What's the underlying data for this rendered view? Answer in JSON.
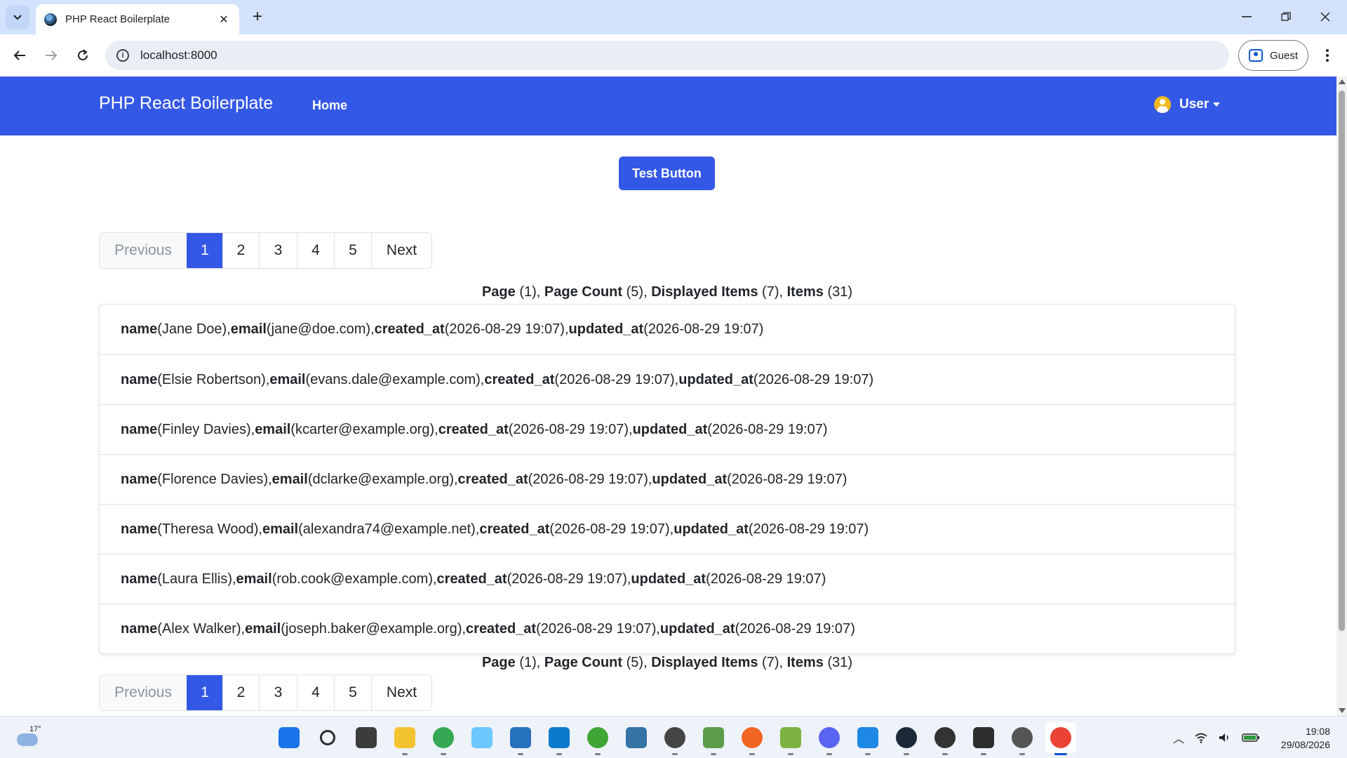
{
  "browser": {
    "tab_title": "PHP React Boilerplate",
    "url": "localhost:8000",
    "profile_label": "Guest"
  },
  "navbar": {
    "brand": "PHP React Boilerplate",
    "home_link": "Home",
    "user_label": "User"
  },
  "test_button": "Test Button",
  "pagination": {
    "previous": "Previous",
    "next": "Next",
    "pages": [
      "1",
      "2",
      "3",
      "4",
      "5"
    ],
    "active_page": "1"
  },
  "summary": {
    "page_label": "Page",
    "page_value": "(1)",
    "page_count_label": "Page Count",
    "page_count_value": "(5)",
    "displayed_label": "Displayed Items",
    "displayed_value": "(7)",
    "items_label": "Items",
    "items_value": "(31)"
  },
  "field_labels": {
    "name": "name",
    "email": "email",
    "created_at": "created_at",
    "updated_at": "updated_at"
  },
  "users": [
    {
      "name": "Jane Doe",
      "email": "jane@doe.com",
      "created_at": "2026-08-29 19:07",
      "updated_at": "2026-08-29 19:07"
    },
    {
      "name": "Elsie Robertson",
      "email": "evans.dale@example.com",
      "created_at": "2026-08-29 19:07",
      "updated_at": "2026-08-29 19:07"
    },
    {
      "name": "Finley Davies",
      "email": "kcarter@example.org",
      "created_at": "2026-08-29 19:07",
      "updated_at": "2026-08-29 19:07"
    },
    {
      "name": "Florence Davies",
      "email": "dclarke@example.org",
      "created_at": "2026-08-29 19:07",
      "updated_at": "2026-08-29 19:07"
    },
    {
      "name": "Theresa Wood",
      "email": "alexandra74@example.net",
      "created_at": "2026-08-29 19:07",
      "updated_at": "2026-08-29 19:07"
    },
    {
      "name": "Laura Ellis",
      "email": "rob.cook@example.com",
      "created_at": "2026-08-29 19:07",
      "updated_at": "2026-08-29 19:07"
    },
    {
      "name": "Alex Walker",
      "email": "joseph.baker@example.org",
      "created_at": "2026-08-29 19:07",
      "updated_at": "2026-08-29 19:07"
    }
  ],
  "taskbar": {
    "weather_temp": "17°",
    "time": "19:08",
    "date": "29/08/2026",
    "apps": [
      {
        "name": "start-icon",
        "color": "#1a73e8"
      },
      {
        "name": "search-icon",
        "color": "#2b2b2b"
      },
      {
        "name": "task-view-icon",
        "color": "#3c3c3c"
      },
      {
        "name": "file-explorer-icon",
        "color": "#f4c430"
      },
      {
        "name": "chrome-canary-icon",
        "color": "#34a853"
      },
      {
        "name": "gem-icon",
        "color": "#6ec6ff"
      },
      {
        "name": "powershell-icon",
        "color": "#2671be"
      },
      {
        "name": "vscode-icon",
        "color": "#0a7acc"
      },
      {
        "name": "utorrent-icon",
        "color": "#3fa535"
      },
      {
        "name": "python-icon",
        "color": "#3572a5"
      },
      {
        "name": "soccer-ball-icon",
        "color": "#444444"
      },
      {
        "name": "translate-icon",
        "color": "#5a9c4a"
      },
      {
        "name": "compass-icon",
        "color": "#f26522"
      },
      {
        "name": "image-editor-icon",
        "color": "#7cb342"
      },
      {
        "name": "discord-icon",
        "color": "#5865f2"
      },
      {
        "name": "appstore-icon",
        "color": "#1e88e5"
      },
      {
        "name": "steam-icon",
        "color": "#1b2838"
      },
      {
        "name": "chatgpt-icon",
        "color": "#333333"
      },
      {
        "name": "terminal-icon",
        "color": "#2d2d2d"
      },
      {
        "name": "soccer-ball-icon-2",
        "color": "#555555"
      },
      {
        "name": "chrome-icon",
        "color": "#ea4335"
      }
    ]
  }
}
